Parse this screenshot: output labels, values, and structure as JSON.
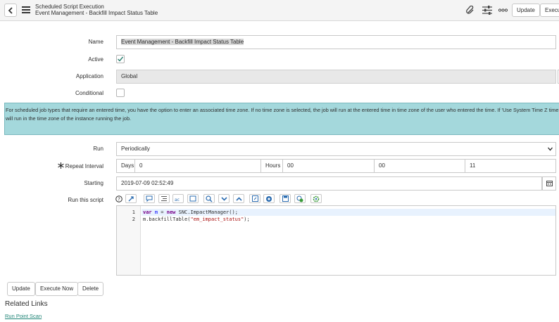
{
  "header": {
    "subtitle": "Scheduled Script Execution",
    "title": "Event Management - Backfill Impact Status Table",
    "update_label": "Update",
    "execute_label": "Execu"
  },
  "form": {
    "name": {
      "label": "Name",
      "value": "Event Management - Backfill Impact Status Table"
    },
    "active": {
      "label": "Active",
      "checked": true
    },
    "application": {
      "label": "Application",
      "value": "Global"
    },
    "conditional": {
      "label": "Conditional",
      "checked": false
    },
    "info_text": "For scheduled job types that require an entered time, you have the option to enter an associated time zone. If no time zone is selected, the job will run at the entered time in time zone of the user who entered the time. If 'Use System Time Z time will run in the time zone of the instance running the job.",
    "run": {
      "label": "Run",
      "value": "Periodically"
    },
    "repeat_interval": {
      "label": "Repeat Interval",
      "days_label": "Days",
      "days_value": "0",
      "hours_label": "Hours",
      "hours_value": "00",
      "minutes_value": "00",
      "seconds_value": "11"
    },
    "starting": {
      "label": "Starting",
      "value": "2019-07-09 02:52:49"
    },
    "script": {
      "label": "Run this script",
      "lines": [
        {
          "num": "1",
          "text": "var m = new SNC.ImpactManager();"
        },
        {
          "num": "2",
          "text": "m.backfillTable(\"em_impact_status\");"
        }
      ]
    }
  },
  "buttons": {
    "update": "Update",
    "execute_now": "Execute Now",
    "delete": "Delete"
  },
  "related": {
    "title": "Related Links",
    "link": "Run Point Scan"
  },
  "colors": {
    "info_bg": "#a4d8dc",
    "link": "#1f8476",
    "header_bg": "#f4f4f4"
  },
  "icons": [
    "back-icon",
    "menu-icon",
    "attachment-icon",
    "settings-sliders-icon",
    "more-icon",
    "calendar-icon",
    "help-icon",
    "chevron-down-icon"
  ]
}
